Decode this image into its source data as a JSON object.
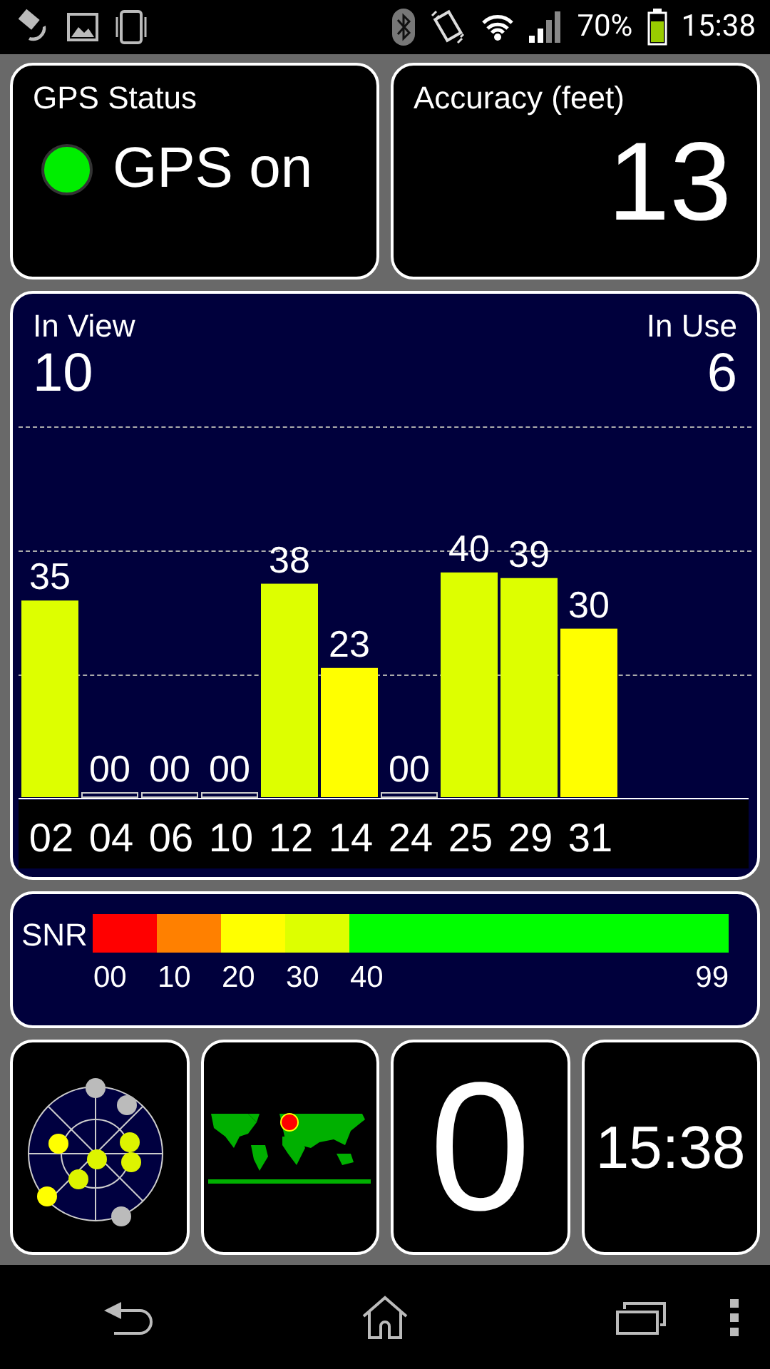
{
  "status_bar": {
    "battery": "70%",
    "time": "15:38"
  },
  "gps_status": {
    "title": "GPS Status",
    "label": "GPS on",
    "on": true
  },
  "accuracy": {
    "title": "Accuracy (feet)",
    "value": "13"
  },
  "satellites": {
    "in_view_label": "In View",
    "in_view": "10",
    "in_use_label": "In Use",
    "in_use": "6",
    "chart_data": {
      "type": "bar",
      "categories": [
        "02",
        "04",
        "06",
        "10",
        "12",
        "14",
        "24",
        "25",
        "29",
        "31"
      ],
      "values": [
        35,
        0,
        0,
        0,
        38,
        23,
        0,
        40,
        39,
        30
      ],
      "value_labels": [
        "35",
        "00",
        "00",
        "00",
        "38",
        "23",
        "00",
        "40",
        "39",
        "30"
      ],
      "data_labels": true
    }
  },
  "snr": {
    "label": "SNR",
    "segments": [
      {
        "color": "#ff0000",
        "label": "00"
      },
      {
        "color": "#ff8000",
        "label": "10"
      },
      {
        "color": "#ffff00",
        "label": "20"
      },
      {
        "color": "#ddff00",
        "label": "30"
      },
      {
        "color": "#00ff00",
        "label": "40"
      }
    ],
    "end_label": "99"
  },
  "tiles": [
    {
      "kind": "radar"
    },
    {
      "kind": "map"
    },
    {
      "kind": "number",
      "value": "0"
    },
    {
      "kind": "clock",
      "value": "15:38"
    }
  ]
}
